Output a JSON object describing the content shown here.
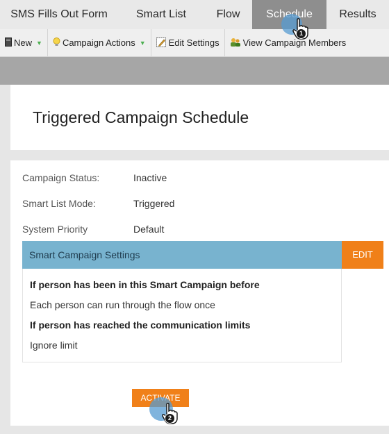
{
  "tabs": [
    {
      "label": "SMS Fills Out Form"
    },
    {
      "label": "Smart List"
    },
    {
      "label": "Flow"
    },
    {
      "label": "Schedule"
    },
    {
      "label": "Results"
    }
  ],
  "toolbar": {
    "new_label": "New",
    "campaign_actions_label": "Campaign Actions",
    "edit_settings_label": "Edit Settings",
    "view_members_label": "View Campaign Members"
  },
  "page": {
    "title": "Triggered Campaign Schedule"
  },
  "details": [
    {
      "label": "Campaign Status:",
      "value": "Inactive"
    },
    {
      "label": "Smart List Mode:",
      "value": "Triggered"
    },
    {
      "label": "System Priority",
      "value": "Default"
    }
  ],
  "settings": {
    "header": "Smart Campaign Settings",
    "edit_label": "EDIT",
    "q1": "If person has been in this Smart Campaign before",
    "a1": "Each person can run through the flow once",
    "q2": "If person has reached the communication limits",
    "a2": "Ignore limit"
  },
  "activate_label": "ACTIVATE",
  "annotations": {
    "step1": "1",
    "step2": "2"
  },
  "colors": {
    "accent_orange": "#f08019",
    "settings_header": "#78b3cf",
    "active_tab": "#8e8e8e",
    "click_halo": "#569bd2"
  }
}
